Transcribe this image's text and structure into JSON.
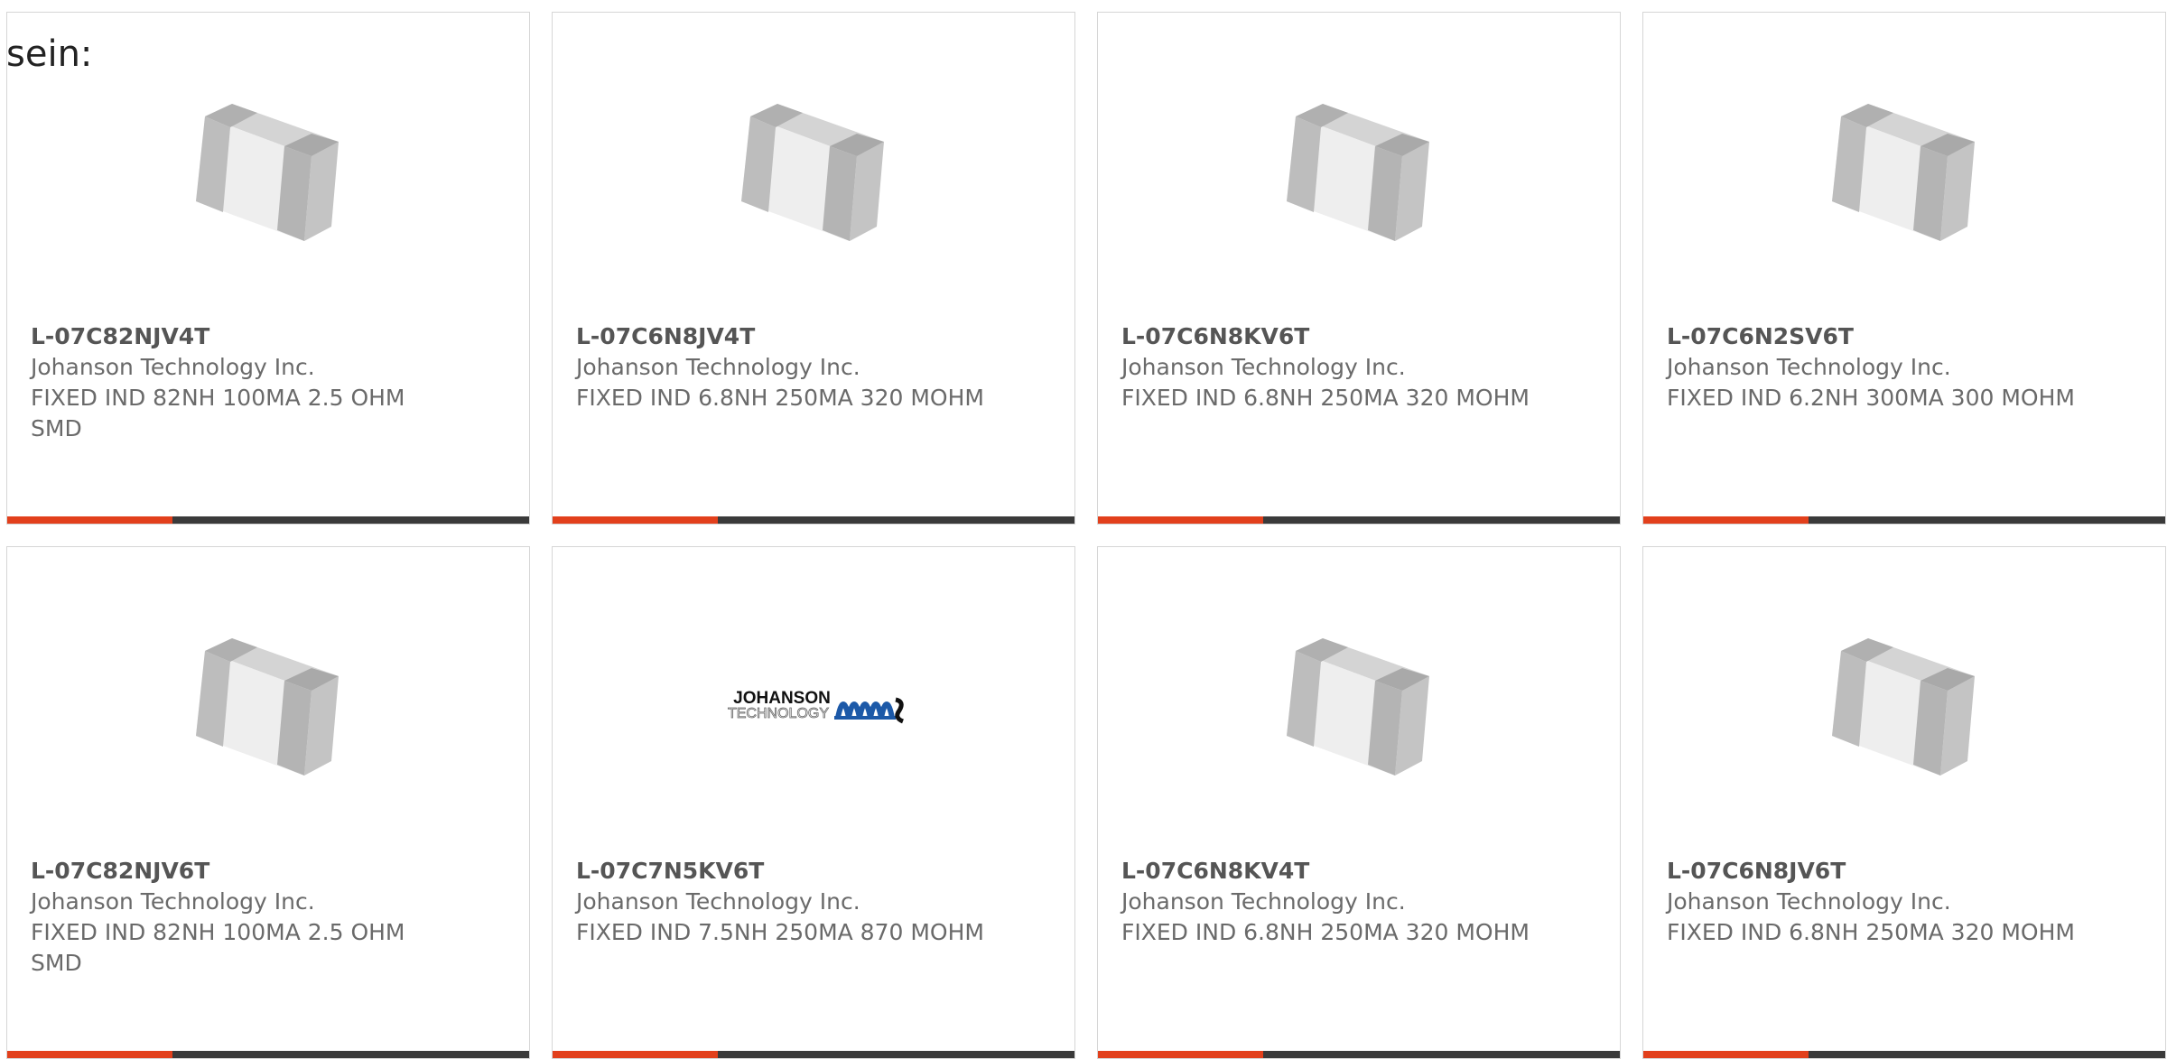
{
  "intro_text": "sein:",
  "colors": {
    "accent": "#e2401c",
    "bar": "#3a3a3a",
    "card_border": "#d6d6d6",
    "part_number": "#555555",
    "body_text": "#6a6a6a"
  },
  "products": [
    {
      "part": "L-07C82NJV4T",
      "manufacturer": "Johanson Technology Inc.",
      "description": "FIXED IND 82NH 100MA 2.5 OHM SMD",
      "image": "smd-inductor-icon"
    },
    {
      "part": "L-07C6N8JV4T",
      "manufacturer": "Johanson Technology Inc.",
      "description": "FIXED IND 6.8NH 250MA 320 MOHM",
      "image": "smd-inductor-icon"
    },
    {
      "part": "L-07C6N8KV6T",
      "manufacturer": "Johanson Technology Inc.",
      "description": "FIXED IND 6.8NH 250MA 320 MOHM",
      "image": "smd-inductor-icon"
    },
    {
      "part": "L-07C6N2SV6T",
      "manufacturer": "Johanson Technology Inc.",
      "description": "FIXED IND 6.2NH 300MA 300 MOHM",
      "image": "smd-inductor-icon"
    },
    {
      "part": "L-07C82NJV6T",
      "manufacturer": "Johanson Technology Inc.",
      "description": "FIXED IND 82NH 100MA 2.5 OHM SMD",
      "image": "smd-inductor-icon"
    },
    {
      "part": "L-07C7N5KV6T",
      "manufacturer": "Johanson Technology Inc.",
      "description": "FIXED IND 7.5NH 250MA 870 MOHM",
      "image": "johanson-logo",
      "logo_line1": "JOHANSON",
      "logo_line2": "TECHNOLOGY"
    },
    {
      "part": "L-07C6N8KV4T",
      "manufacturer": "Johanson Technology Inc.",
      "description": "FIXED IND 6.8NH 250MA 320 MOHM",
      "image": "smd-inductor-icon"
    },
    {
      "part": "L-07C6N8JV6T",
      "manufacturer": "Johanson Technology Inc.",
      "description": "FIXED IND 6.8NH 250MA 320 MOHM",
      "image": "smd-inductor-icon"
    }
  ]
}
